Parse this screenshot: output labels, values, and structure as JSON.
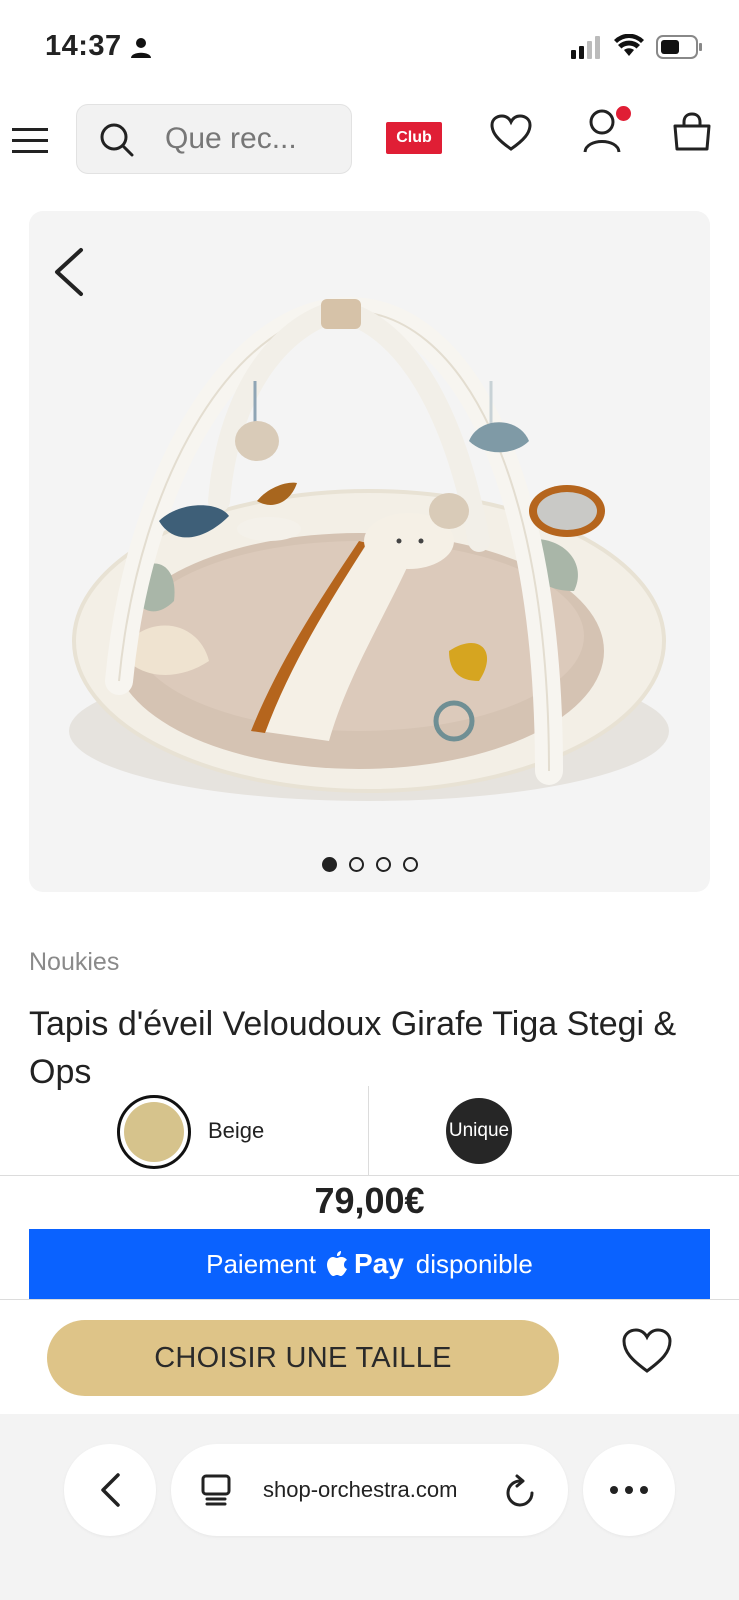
{
  "status_bar": {
    "time": "14:37"
  },
  "header": {
    "search_placeholder": "Que rec...",
    "club_label": "Club"
  },
  "gallery": {
    "image_count": 4,
    "active_index": 0
  },
  "product": {
    "brand": "Noukies",
    "title": "Tapis d'éveil Veloudoux Girafe Tiga Stegi & Ops",
    "color_label": "Beige",
    "size_label": "Unique",
    "price": "79,00€"
  },
  "apple_pay": {
    "prefix": "Paiement",
    "pay_word": "Pay",
    "suffix": "disponible"
  },
  "cta": {
    "label": "CHOISIR UNE TAILLE"
  },
  "browser": {
    "url": "shop-orchestra.com"
  },
  "colors": {
    "accent_red": "#e01e35",
    "cta_gold": "#dec488",
    "apple_pay_blue": "#0a62ff",
    "swatch_beige": "#d6c38c"
  }
}
